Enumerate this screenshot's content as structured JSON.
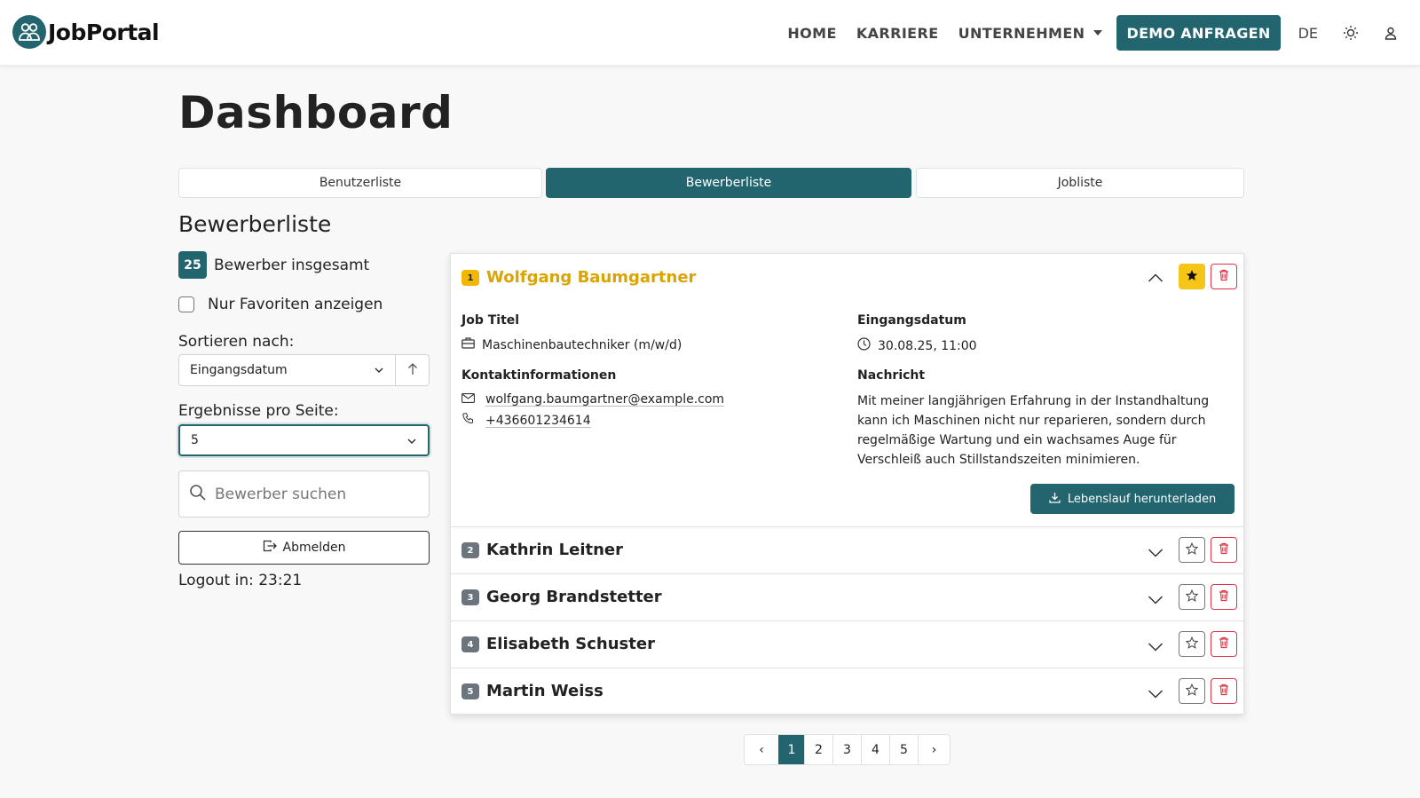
{
  "nav": {
    "brand": "JobPortal",
    "links": [
      "HOME",
      "KARRIERE",
      "UNTERNEHMEN"
    ],
    "demo_button": "DEMO ANFRAGEN",
    "language": "DE"
  },
  "page": {
    "title": "Dashboard",
    "tabs": [
      "Benutzerliste",
      "Bewerberliste",
      "Jobliste"
    ],
    "active_tab": "Bewerberliste"
  },
  "sidebar": {
    "section_title": "Bewerberliste",
    "total_count": "25",
    "total_label": "Bewerber insgesamt",
    "favorites_label": "Nur Favoriten anzeigen",
    "favorites_checked": false,
    "sort_label": "Sortieren nach:",
    "sort_value": "Eingangsdatum",
    "per_page_label": "Ergebnisse pro Seite:",
    "per_page_value": "5",
    "search_placeholder": "Bewerber suchen",
    "logout_button": "Abmelden",
    "logout_timer": "Logout in: 23:21"
  },
  "applicants": [
    {
      "num": "1",
      "name": "Wolfgang Baumgartner",
      "favorite": true,
      "expanded": true
    },
    {
      "num": "2",
      "name": "Kathrin Leitner",
      "favorite": false,
      "expanded": false
    },
    {
      "num": "3",
      "name": "Georg Brandstetter",
      "favorite": false,
      "expanded": false
    },
    {
      "num": "4",
      "name": "Elisabeth Schuster",
      "favorite": false,
      "expanded": false
    },
    {
      "num": "5",
      "name": "Martin Weiss",
      "favorite": false,
      "expanded": false
    }
  ],
  "detail": {
    "job_title_label": "Job Titel",
    "job_title": "Maschinenbautechniker (m/w/d)",
    "date_label": "Eingangsdatum",
    "date": "30.08.25, 11:00",
    "contact_label": "Kontaktinformationen",
    "email": "wolfgang.baumgartner@example.com",
    "phone": "+436601234614",
    "message_label": "Nachricht",
    "message": "Mit meiner langjährigen Erfahrung in der Instandhaltung kann ich Maschinen nicht nur reparieren, sondern durch regelmäßige Wartung und ein wachsames Auge für Verschleiß auch Stillstandszeiten minimieren.",
    "cv_button": "Lebenslauf herunterladen"
  },
  "pagination": {
    "prev": "‹",
    "pages": [
      "1",
      "2",
      "3",
      "4",
      "5"
    ],
    "current": "1",
    "next": "›"
  },
  "colors": {
    "primary": "#22656f",
    "favorite": "#f5c518",
    "danger": "#dc3545"
  }
}
